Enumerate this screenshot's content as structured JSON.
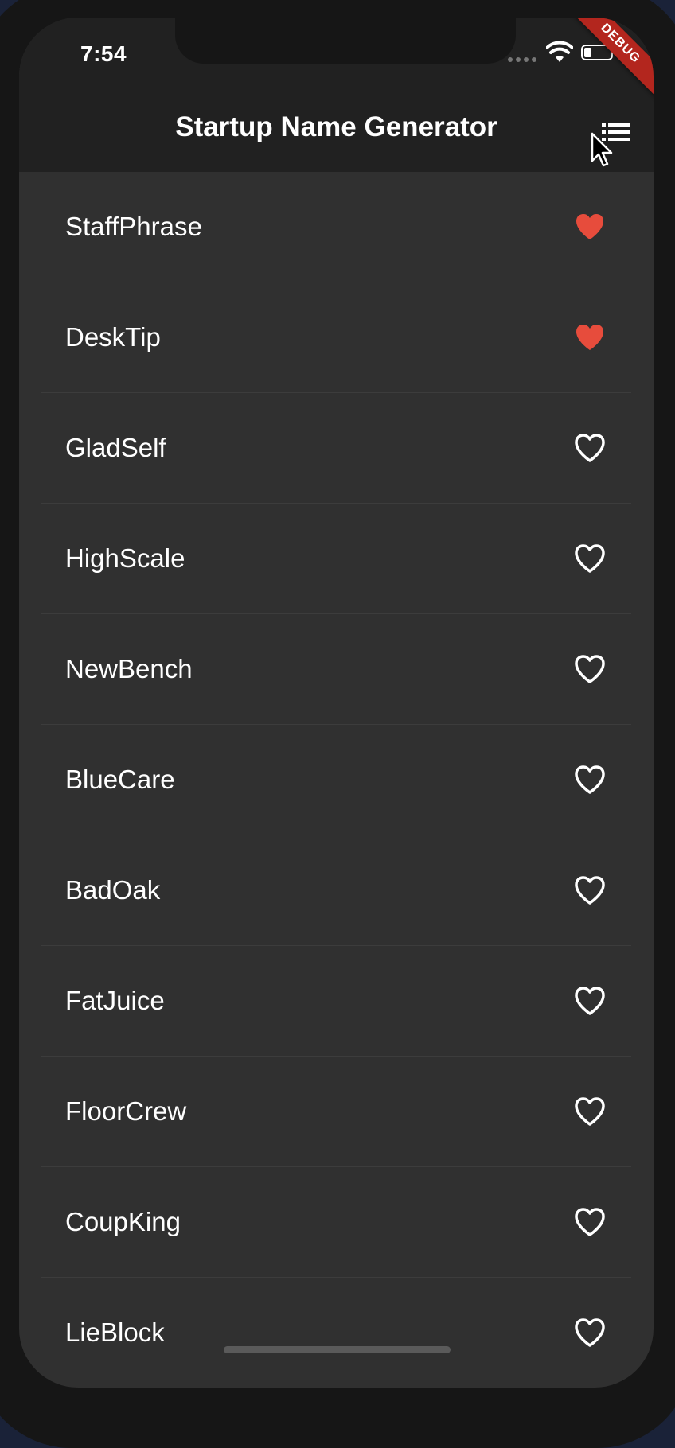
{
  "status_bar": {
    "time": "7:54",
    "debug_label": "DEBUG"
  },
  "app_bar": {
    "title": "Startup Name Generator",
    "action_icon": "list-icon"
  },
  "colors": {
    "appbar": "#212121",
    "background": "#303030",
    "favorite": "#e74c3c",
    "text": "#ffffff"
  },
  "suggestions": [
    {
      "name": "StaffPhrase",
      "favorite": true
    },
    {
      "name": "DeskTip",
      "favorite": true
    },
    {
      "name": "GladSelf",
      "favorite": false
    },
    {
      "name": "HighScale",
      "favorite": false
    },
    {
      "name": "NewBench",
      "favorite": false
    },
    {
      "name": "BlueCare",
      "favorite": false
    },
    {
      "name": "BadOak",
      "favorite": false
    },
    {
      "name": "FatJuice",
      "favorite": false
    },
    {
      "name": "FloorCrew",
      "favorite": false
    },
    {
      "name": "CoupKing",
      "favorite": false
    },
    {
      "name": "LieBlock",
      "favorite": false
    }
  ]
}
